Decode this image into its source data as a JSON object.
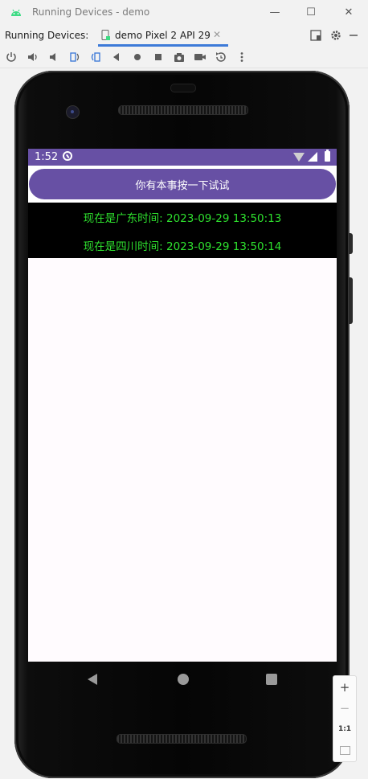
{
  "window": {
    "title": "Running Devices - demo",
    "minimize_glyph": "—",
    "maximize_glyph": "☐",
    "close_glyph": "✕"
  },
  "tabs": {
    "caption": "Running Devices:",
    "device_tab_label": "demo Pixel 2 API 29",
    "close_glyph": "✕"
  },
  "toolbar_icons": [
    "power-icon",
    "volume-up-icon",
    "volume-down-icon",
    "rotate-left-icon",
    "rotate-right-icon",
    "fold-icon",
    "back-icon",
    "home-icon",
    "overview-icon",
    "screenshot-icon",
    "screen-record-icon",
    "reset-icon",
    "more-options-icon"
  ],
  "device_screen": {
    "status_time": "1:52",
    "button_label": "你有本事按一下试试",
    "time_guangdong": "现在是广东时间: 2023-09-29 13:50:13",
    "time_sichuan": "现在是四川时间: 2023-09-29 13:50:14"
  },
  "zoom": {
    "zoom_in": "+",
    "zoom_out": "−",
    "actual_size": "1:1"
  },
  "colors": {
    "accent": "#6750a4",
    "text_green": "#2ee02e",
    "tab_underline": "#3d7ad8"
  }
}
